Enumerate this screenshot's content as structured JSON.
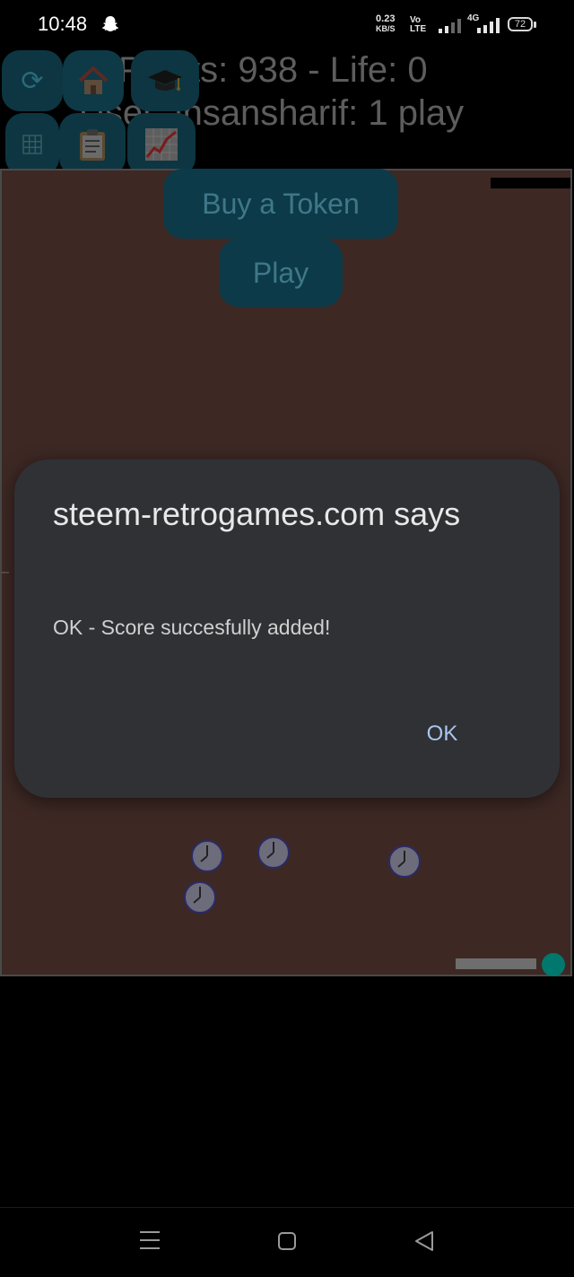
{
  "status_bar": {
    "time": "10:48",
    "net_speed_value": "0.23",
    "net_speed_unit": "KB/S",
    "volte_top": "Vo",
    "volte_bottom": "LTE",
    "network": "4G",
    "battery": "72"
  },
  "header": {
    "points_text": "Points: 938 - Life: 0",
    "user_text": "User: insansharif: 1 play"
  },
  "toolbar": {
    "icons": [
      "refresh-icon",
      "home-icon",
      "graduation-cap-icon",
      "grid-icon",
      "clipboard-icon",
      "chart-icon"
    ]
  },
  "game": {
    "buy_token_label": "Buy a Token",
    "play_label": "Play"
  },
  "dialog": {
    "title": "steem-retrogames.com says",
    "message": "OK - Score succesfully added!",
    "ok_label": "OK"
  },
  "colors": {
    "game_background": "#3d2824",
    "dialog_background": "#2f3135",
    "ok_text": "#a8c6f0",
    "player": "#00786e"
  }
}
